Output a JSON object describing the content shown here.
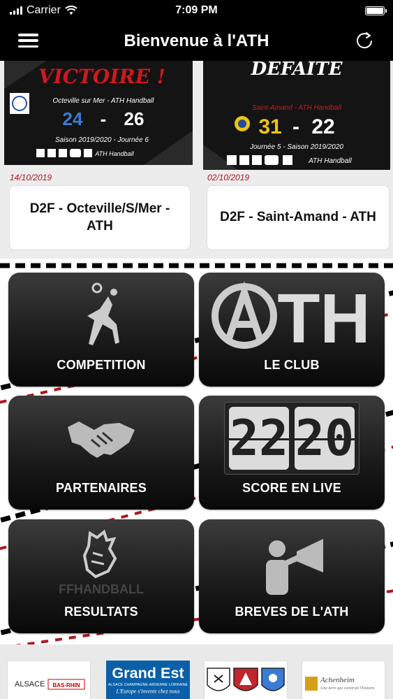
{
  "status_bar": {
    "carrier": "Carrier",
    "time": "7:09 PM",
    "battery_percent": 100
  },
  "header": {
    "title": "Bienvenue à l'ATH"
  },
  "news": [
    {
      "date": "14/10/2019",
      "title": "D2F - Octeville/S/Mer - ATH",
      "image": {
        "headline": "VICTOIRE !",
        "match": "Octeville sur Mer - ATH Handball",
        "score_home": "24",
        "score_away": "26",
        "season": "Saison 2019/2020 - Journée 6",
        "social": "ATH Handball"
      }
    },
    {
      "date": "02/10/2019",
      "title": "D2F - Saint-Amand - ATH",
      "image": {
        "headline": "DEFAITE",
        "match": "Saint-Amand - ATH Handball",
        "score_home": "31",
        "score_away": "22",
        "season": "Journée 5 - Saison 2019/2020",
        "social": "ATH Handball"
      }
    }
  ],
  "tiles": [
    {
      "label": "COMPETITION",
      "icon": "handball-player-icon"
    },
    {
      "label": "LE CLUB",
      "icon": "ath-logo-icon",
      "logo_text": "TH"
    },
    {
      "label": "PARTENAIRES",
      "icon": "handshake-icon"
    },
    {
      "label": "SCORE EN LIVE",
      "icon": "flip-clock-icon",
      "clock_left": "22",
      "clock_right": "20"
    },
    {
      "label": "RESULTATS",
      "icon": "ffhandball-rooster-icon",
      "logo_text": "FFHANDBALL"
    },
    {
      "label": "BREVES DE L'ATH",
      "icon": "megaphone-person-icon"
    }
  ],
  "sponsors": [
    {
      "name": "ALSACE BAS-RHIN",
      "left": "ALSACE",
      "right": "BAS-RHIN"
    },
    {
      "name": "Grand Est",
      "title": "Grand Est",
      "subtitle": "ALSACE CHAMPAGNE-ARDENNE LORRAINE",
      "tagline": "L'Europe s'invente chez nous"
    },
    {
      "name": "coats-of-arms"
    },
    {
      "name": "Achenheim",
      "title": "Achenheim",
      "tagline": "Une terre qui construit l'histoire"
    }
  ],
  "colors": {
    "header_bg": "#000000",
    "accent_red": "#b0141d",
    "tile_dark": "#1c1c1c",
    "flip_card": "#dcdcdc",
    "grand_est_blue": "#0a5fa8"
  }
}
